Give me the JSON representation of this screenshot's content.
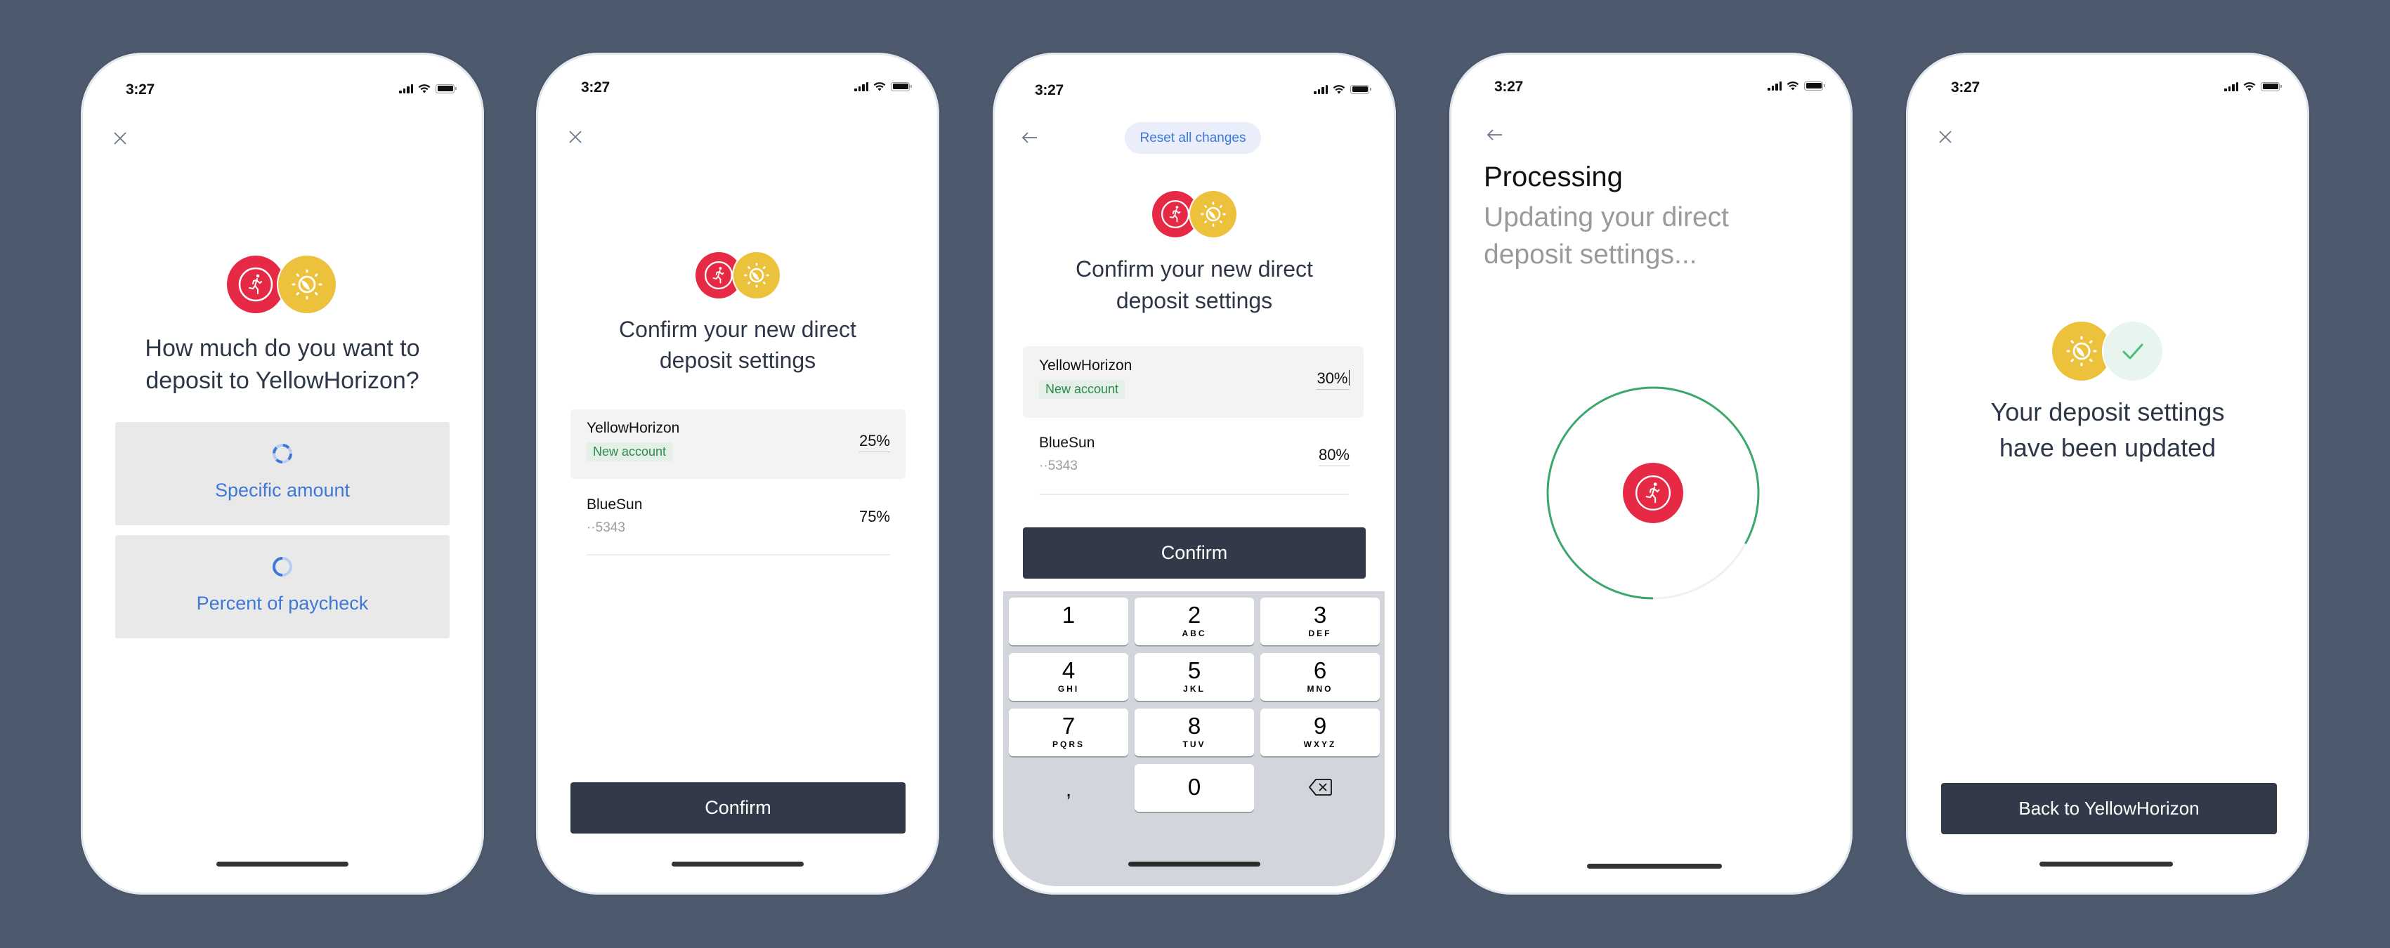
{
  "colors": {
    "background": "#4d5a6d",
    "brand_red": "#e62a45",
    "brand_yellow": "#ecc13b",
    "accent_blue": "#3f78d8",
    "success_green": "#2f8a4e",
    "progress_green": "#3aa86c",
    "primary_button": "#323a4a"
  },
  "screens": [
    {
      "status": {
        "time": "3:27"
      },
      "nav_icon": "close-icon",
      "brand_icons": [
        "running-person-icon",
        "sun-leaf-icon"
      ],
      "title_lines": [
        "How much do you want to",
        "deposit to YellowHorizon?"
      ],
      "options": [
        {
          "label": "Specific amount",
          "icon": "loading-spinner-icon"
        },
        {
          "label": "Percent of paycheck",
          "icon": "loading-spinner-icon"
        }
      ]
    },
    {
      "status": {
        "time": "3:27"
      },
      "nav_icon": "close-icon",
      "brand_icons": [
        "running-person-icon",
        "sun-leaf-icon"
      ],
      "title_lines": [
        "Confirm your new direct",
        "deposit settings"
      ],
      "accounts": [
        {
          "name": "YellowHorizon",
          "badge": "New account",
          "percent": "25%"
        },
        {
          "name": "BlueSun",
          "account_mask": "··5343",
          "percent": "75%"
        }
      ],
      "confirm_label": "Confirm"
    },
    {
      "status": {
        "time": "3:27"
      },
      "nav_icon": "back-arrow-icon",
      "reset_label": "Reset all changes",
      "brand_icons": [
        "running-person-icon",
        "sun-leaf-icon"
      ],
      "title_lines": [
        "Confirm your new direct",
        "deposit settings"
      ],
      "accounts": [
        {
          "name": "YellowHorizon",
          "badge": "New account",
          "percent": "30%"
        },
        {
          "name": "BlueSun",
          "account_mask": "··5343",
          "percent": "80%"
        }
      ],
      "confirm_label": "Confirm",
      "keypad": [
        {
          "digit": "1",
          "letters": ""
        },
        {
          "digit": "2",
          "letters": "ABC"
        },
        {
          "digit": "3",
          "letters": "DEF"
        },
        {
          "digit": "4",
          "letters": "GHI"
        },
        {
          "digit": "5",
          "letters": "JKL"
        },
        {
          "digit": "6",
          "letters": "MNO"
        },
        {
          "digit": "7",
          "letters": "PQRS"
        },
        {
          "digit": "8",
          "letters": "TUV"
        },
        {
          "digit": "9",
          "letters": "WXYZ"
        },
        {
          "digit": ",",
          "letters": ""
        },
        {
          "digit": "0",
          "letters": ""
        },
        {
          "digit": "",
          "letters": "",
          "icon": "backspace-icon"
        }
      ]
    },
    {
      "status": {
        "time": "3:27"
      },
      "nav_icon": "back-arrow-icon",
      "title": "Processing",
      "subtitle": "Updating your direct deposit settings...",
      "progress": 0.83,
      "brand_icons": [
        "running-person-icon"
      ]
    },
    {
      "status": {
        "time": "3:27"
      },
      "nav_icon": "close-icon",
      "brand_icons": [
        "sun-leaf-icon",
        "checkmark-icon"
      ],
      "title_lines": [
        "Your deposit settings",
        "have been updated"
      ],
      "button_label": "Back to YellowHorizon"
    }
  ]
}
